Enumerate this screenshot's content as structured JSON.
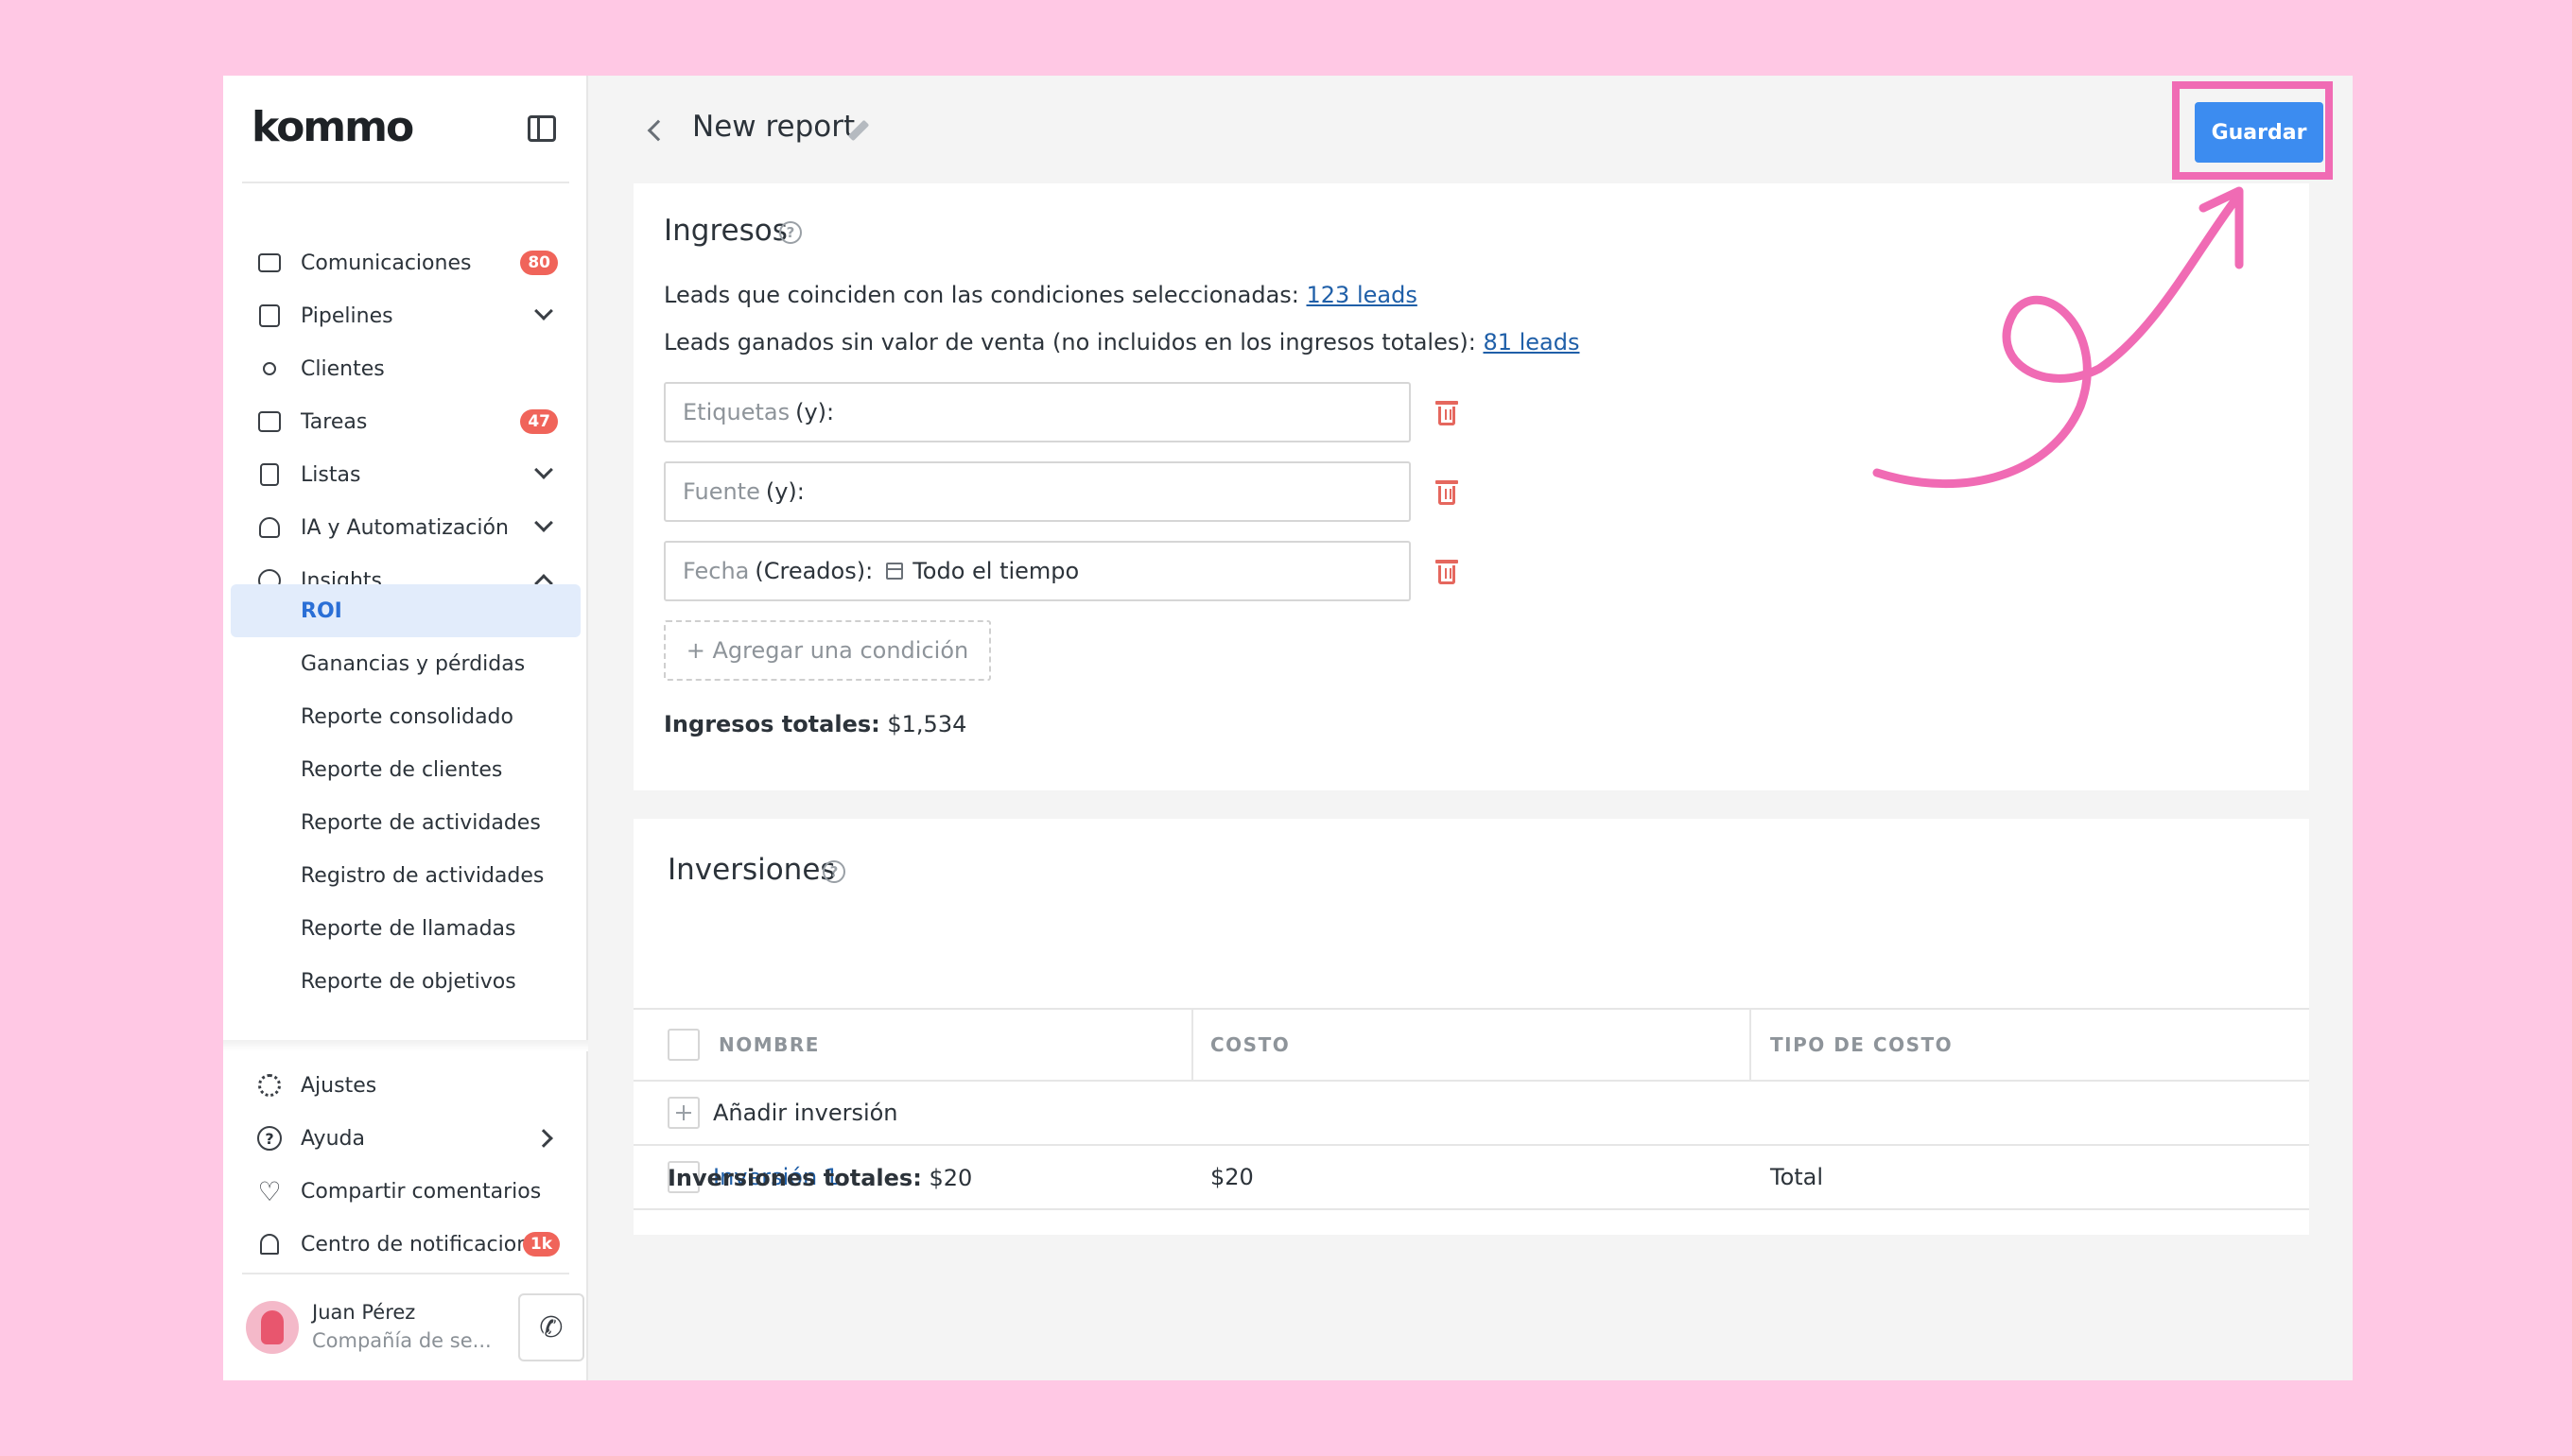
{
  "logo": "kommo",
  "sidebar": {
    "items": [
      {
        "label": "Comunicaciones",
        "badge": "80",
        "icon": "chat-icon"
      },
      {
        "label": "Pipelines",
        "icon": "pipeline-icon"
      },
      {
        "label": "Clientes",
        "icon": "users-icon"
      },
      {
        "label": "Tareas",
        "badge": "47",
        "icon": "calendar-icon"
      },
      {
        "label": "Listas",
        "icon": "list-icon"
      },
      {
        "label": "IA y Automatización",
        "icon": "automation-icon"
      },
      {
        "label": "Insights",
        "icon": "pie-chart-icon"
      }
    ],
    "insights_sub": [
      "ROI",
      "Ganancias y pérdidas",
      "Reporte consolidado",
      "Reporte de clientes",
      "Reporte de actividades",
      "Registro de actividades",
      "Reporte de llamadas",
      "Reporte de objetivos"
    ],
    "bottom": [
      {
        "label": "Ajustes",
        "icon": "gear-icon"
      },
      {
        "label": "Ayuda",
        "icon": "help-icon"
      },
      {
        "label": "Compartir comentarios",
        "icon": "heart-icon"
      },
      {
        "label": "Centro de notificaciones",
        "badge": "1k",
        "icon": "bell-icon"
      }
    ],
    "user": {
      "name": "Juan Pérez",
      "company": "Compañía de se..."
    }
  },
  "header": {
    "title": "New report",
    "save_label": "Guardar"
  },
  "ingresos": {
    "title": "Ingresos",
    "matching_text": "Leads que coinciden con las condiciones seleccionadas:",
    "matching_link": "123 leads",
    "won_text": "Leads ganados sin valor de venta (no incluidos en los ingresos totales):",
    "won_link": "81 leads",
    "conditions": [
      {
        "key": "Etiquetas",
        "op": "(y):",
        "value": ""
      },
      {
        "key": "Fuente",
        "op": "(y):",
        "value": ""
      },
      {
        "key": "Fecha",
        "op": "(Creados):",
        "value": "Todo el tiempo"
      }
    ],
    "add_condition": "+ Agregar una condición",
    "total_label": "Ingresos totales:",
    "total_value": "$1,534"
  },
  "inversiones": {
    "title": "Inversiones",
    "columns": [
      "NOMBRE",
      "COSTO",
      "TIPO DE COSTO"
    ],
    "add_label": "Añadir inversión",
    "rows": [
      {
        "name": "Inversión 1",
        "cost": "$20",
        "type": "Total"
      }
    ],
    "total_label": "Inversiones totales:",
    "total_value": "$20"
  },
  "colors": {
    "accent": "#3c8cf0",
    "annotation": "#f06bb4",
    "badge": "#f0645a",
    "background": "#ffc8e4"
  }
}
